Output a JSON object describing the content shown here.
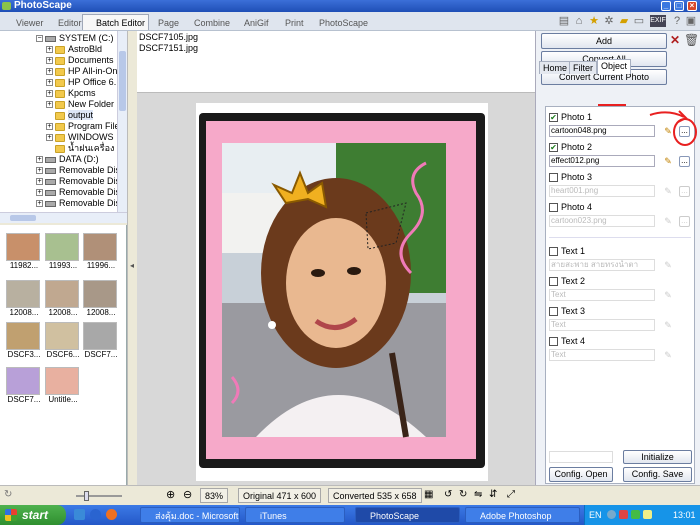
{
  "window": {
    "title": "PhotoScape"
  },
  "tabs": [
    {
      "label": "Viewer",
      "color": "#6a9fe0"
    },
    {
      "label": "Editor",
      "color": "#7aa0d0"
    },
    {
      "label": "Batch Editor",
      "color": "#e08040"
    },
    {
      "label": "Page",
      "color": "#d06060"
    },
    {
      "label": "Combine",
      "color": "#6090d0"
    },
    {
      "label": "AniGif",
      "color": "#60b060"
    },
    {
      "label": "Print",
      "color": "#d05050"
    },
    {
      "label": "PhotoScape",
      "color": "#e07040"
    }
  ],
  "tree": [
    {
      "label": "SYSTEM (C:)",
      "kind": "drive"
    },
    {
      "label": "AstroBld",
      "kind": "folder"
    },
    {
      "label": "Documents",
      "kind": "folder"
    },
    {
      "label": "HP All-in-On",
      "kind": "folder"
    },
    {
      "label": "HP Office 6.",
      "kind": "folder"
    },
    {
      "label": "Kpcms",
      "kind": "folder"
    },
    {
      "label": "New Folder",
      "kind": "folder"
    },
    {
      "label": "output",
      "kind": "folder"
    },
    {
      "label": "Program File",
      "kind": "folder"
    },
    {
      "label": "WINDOWS",
      "kind": "folder"
    },
    {
      "label": "น้ำฝนเครื่อง",
      "kind": "folder"
    },
    {
      "label": "DATA (D:)",
      "kind": "drive"
    },
    {
      "label": "Removable Disk",
      "kind": "drive"
    },
    {
      "label": "Removable Disk",
      "kind": "drive"
    },
    {
      "label": "Removable Disk",
      "kind": "drive"
    },
    {
      "label": "Removable Disk",
      "kind": "drive"
    }
  ],
  "thumbnails": [
    {
      "caption": "11982...",
      "color": "#c8906a"
    },
    {
      "caption": "11993...",
      "color": "#a8c090"
    },
    {
      "caption": "11996...",
      "color": "#b09078"
    },
    {
      "caption": "12008...",
      "color": "#b8b0a0"
    },
    {
      "caption": "12008...",
      "color": "#c0a890"
    },
    {
      "caption": "12008...",
      "color": "#a89888"
    },
    {
      "caption": "DSCF3...",
      "color": "#c0a070"
    },
    {
      "caption": "DSCF6...",
      "color": "#d0c0a0"
    },
    {
      "caption": "DSCF7...",
      "color": "#a8a8a8"
    },
    {
      "caption": "DSCF7...",
      "color": "#b8a0d8"
    },
    {
      "caption": "Untitle...",
      "color": "#e8b0a0"
    }
  ],
  "files": [
    "DSCF7105.jpg",
    "DSCF7151.jpg"
  ],
  "actions": {
    "add": "Add",
    "convert_all": "Convert All",
    "convert_current": "Convert Current Photo"
  },
  "right_tabs": [
    "Home",
    "Filter",
    "Object"
  ],
  "objects": {
    "photos": [
      {
        "label": "Photo 1",
        "checked": true,
        "file": "cartoon048.png"
      },
      {
        "label": "Photo 2",
        "checked": true,
        "file": "effect012.png"
      },
      {
        "label": "Photo 3",
        "checked": false,
        "file": "heart001.png"
      },
      {
        "label": "Photo 4",
        "checked": false,
        "file": "cartoon023.png"
      }
    ],
    "texts": [
      {
        "label": "Text 1",
        "checked": false,
        "value": "สายสะพาย สายทรงน้ำตา"
      },
      {
        "label": "Text 2",
        "checked": false,
        "value": "Text"
      },
      {
        "label": "Text 3",
        "checked": false,
        "value": "Text"
      },
      {
        "label": "Text 4",
        "checked": false,
        "value": "Text"
      }
    ],
    "initialize": "Initialize",
    "config_open": "Config. Open",
    "config_save": "Config. Save"
  },
  "status": {
    "zoom": "83%",
    "original": "Original 471 x 600",
    "converted": "Converted 535 x 658"
  },
  "taskbar": {
    "start": "start",
    "items": [
      "ส่งคุ้ม.doc - Microsoft...",
      "iTunes",
      "PhotoScape",
      "Adobe Photoshop"
    ],
    "lang": "EN",
    "clock": "13:01"
  }
}
